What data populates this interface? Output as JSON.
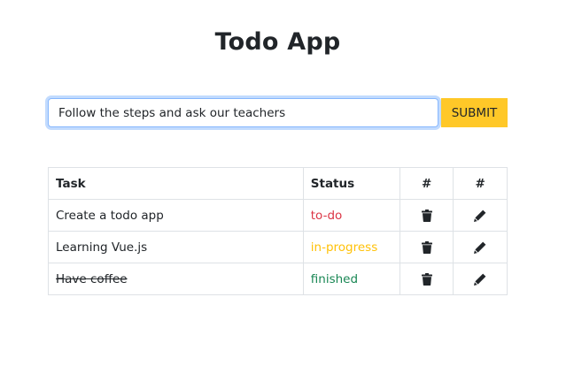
{
  "app": {
    "title": "Todo App"
  },
  "form": {
    "input_value": "Follow the steps and ask our teachers",
    "submit_label": "SUBMIT"
  },
  "table": {
    "headers": {
      "task": "Task",
      "status": "Status",
      "delete": "#",
      "edit": "#"
    },
    "rows": [
      {
        "task": "Create a todo app",
        "status": "to-do",
        "status_color": "#dc3545",
        "finished": false,
        "delete_icon": "trash-icon",
        "edit_icon": "pencil-icon"
      },
      {
        "task": "Learning Vue.js",
        "status": "in-progress",
        "status_color": "#ffc107",
        "finished": false,
        "delete_icon": "trash-icon",
        "edit_icon": "pencil-icon"
      },
      {
        "task": "Have coffee",
        "status": "finished",
        "status_color": "#198754",
        "finished": true,
        "delete_icon": "trash-icon",
        "edit_icon": "pencil-icon"
      }
    ]
  },
  "colors": {
    "submit_bg": "#ffc828",
    "input_focus_border": "#86b7fe",
    "table_border": "#dee2e6",
    "text": "#212529"
  }
}
